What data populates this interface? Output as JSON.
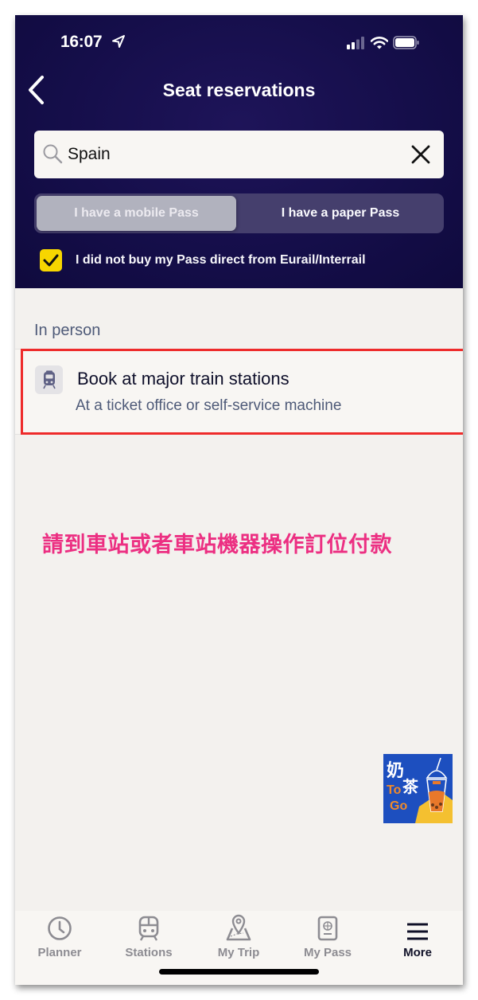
{
  "status_bar": {
    "time": "16:07",
    "icons": [
      "location-arrow-icon",
      "signal-icon",
      "wifi-icon",
      "battery-icon"
    ]
  },
  "nav": {
    "back_icon": "chevron-left-icon",
    "title": "Seat reservations"
  },
  "search": {
    "value": "Spain",
    "icon": "search-icon",
    "clear_icon": "close-icon"
  },
  "pass_toggle": {
    "options": [
      {
        "label": "I have a mobile Pass",
        "selected": true
      },
      {
        "label": "I have a paper Pass",
        "selected": false
      }
    ]
  },
  "checkbox": {
    "label": "I did not buy my Pass direct from Eurail/Interrail",
    "checked": true
  },
  "section": {
    "label": "In person"
  },
  "option": {
    "icon": "train-icon",
    "title": "Book at major train stations",
    "subtitle": "At a ticket office or self-service machine"
  },
  "annotation": {
    "text": "請到車站或者車站機器操作訂位付款",
    "color": "#ec2f82"
  },
  "watermark": {
    "text_line1": "奶茶",
    "text_line2": "To Go"
  },
  "tabbar": {
    "items": [
      {
        "label": "Planner",
        "icon": "clock-icon",
        "active": false
      },
      {
        "label": "Stations",
        "icon": "train-icon",
        "active": false
      },
      {
        "label": "My Trip",
        "icon": "map-pin-icon",
        "active": false
      },
      {
        "label": "My Pass",
        "icon": "passport-icon",
        "active": false
      },
      {
        "label": "More",
        "icon": "menu-icon",
        "active": true
      }
    ]
  },
  "colors": {
    "header_bg": "#150e4a",
    "checkbox_yellow": "#f7d600",
    "highlight_red": "#ee2b2b"
  }
}
